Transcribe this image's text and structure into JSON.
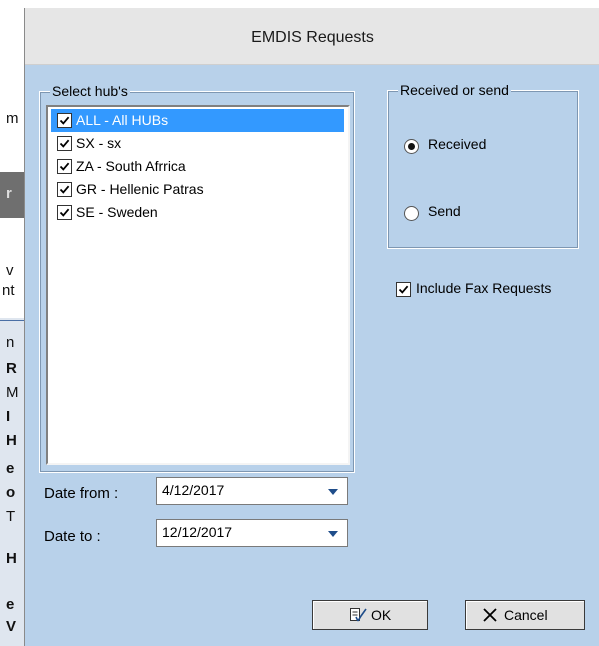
{
  "background_app": {
    "glyphs": [
      "m",
      "r",
      "v",
      "nt",
      "n",
      "R",
      "M",
      "I",
      "H",
      "e",
      "o",
      "T",
      "H",
      "e",
      "V"
    ]
  },
  "dialog": {
    "title": "EMDIS Requests"
  },
  "hubs": {
    "legend": "Select hub's",
    "items": [
      {
        "label": "ALL - All HUBs",
        "checked": true,
        "selected": true
      },
      {
        "label": "SX - sx",
        "checked": true,
        "selected": false
      },
      {
        "label": "ZA - South Afrrica",
        "checked": true,
        "selected": false
      },
      {
        "label": "GR - Hellenic Patras",
        "checked": true,
        "selected": false
      },
      {
        "label": "SE - Sweden",
        "checked": true,
        "selected": false
      }
    ]
  },
  "direction": {
    "legend": "Received or send",
    "options": [
      {
        "label": "Received",
        "selected": true
      },
      {
        "label": "Send",
        "selected": false
      }
    ]
  },
  "include_fax": {
    "label": "Include Fax Requests",
    "checked": true
  },
  "date_from": {
    "label": "Date from :",
    "value": "4/12/2017"
  },
  "date_to": {
    "label": "Date to :",
    "value": "12/12/2017"
  },
  "buttons": {
    "ok": "OK",
    "cancel": "Cancel"
  },
  "colors": {
    "dialog_bg": "#b8d1ea",
    "selection": "#3399ff",
    "titlebar": "#e6e6e6"
  }
}
